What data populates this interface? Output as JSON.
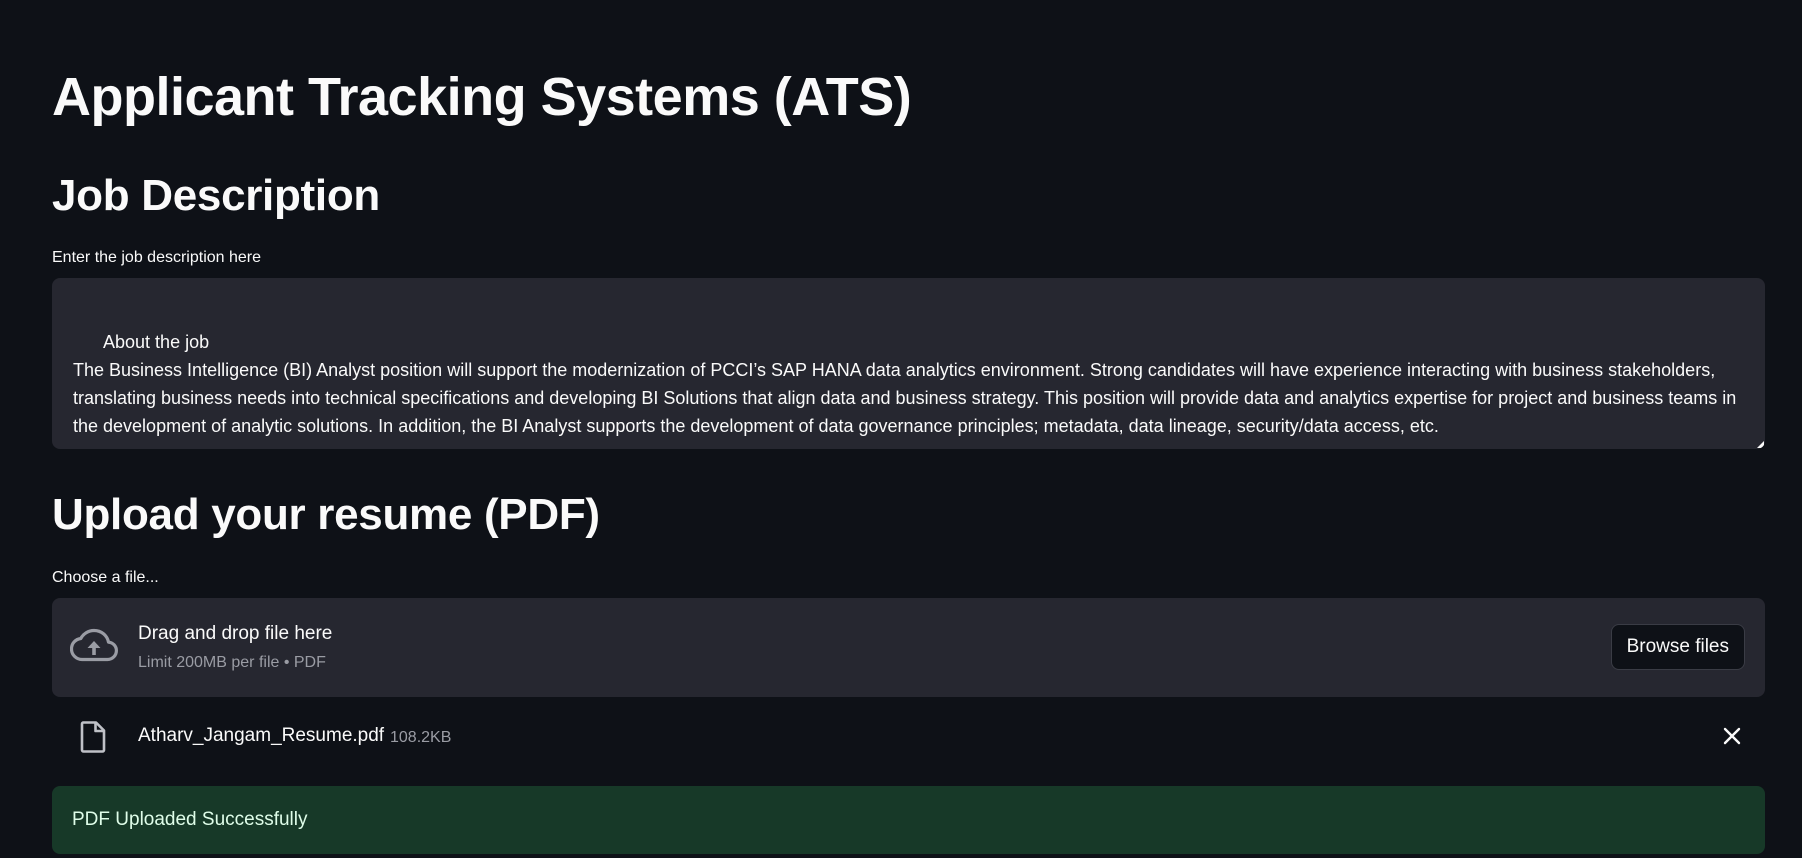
{
  "app": {
    "title": "Applicant Tracking Systems (ATS)"
  },
  "job_description": {
    "heading": "Job Description",
    "label": "Enter the job description here",
    "value": "About the job\nThe Business Intelligence (BI) Analyst position will support the modernization of PCCI’s SAP HANA data analytics environment. Strong candidates will have experience interacting with business stakeholders, translating business needs into technical specifications and developing BI Solutions that align data and business strategy. This position will provide data and analytics expertise for project and business teams in the development of analytic solutions. In addition, the BI Analyst supports the development of data governance principles; metadata, data lineage, security/data access, etc."
  },
  "resume_upload": {
    "heading": "Upload your resume (PDF)",
    "label": "Choose a file...",
    "dropzone_title": "Drag and drop file here",
    "dropzone_limits": "Limit 200MB per file • PDF",
    "browse_label": "Browse files",
    "icon": "cloud-upload-icon"
  },
  "uploaded_file": {
    "name": "Atharv_Jangam_Resume.pdf",
    "size": "108.2KB",
    "icon": "file-icon",
    "remove_icon": "close-icon"
  },
  "status": {
    "message": "PDF Uploaded Successfully",
    "color": "#173928"
  },
  "colors": {
    "background": "#0e1117",
    "input_background": "#262730",
    "text": "#fafafa",
    "muted_text": "#9a9ca4"
  }
}
